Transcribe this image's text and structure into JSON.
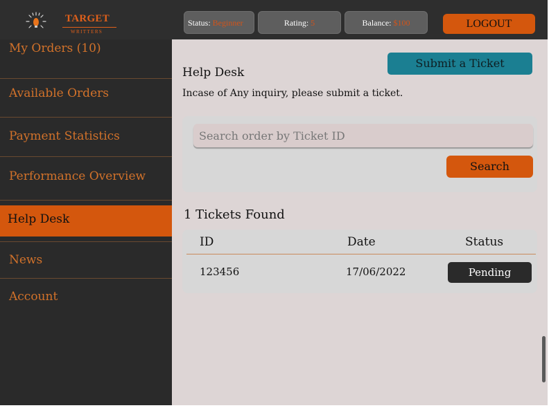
{
  "logo": {
    "title": "TARGET",
    "subtitle": "WRITTERS"
  },
  "header": {
    "status_label": "Status:",
    "status_value": "Beginner",
    "rating_label": "Rating:",
    "rating_value": "5",
    "balance_label": "Balance:",
    "balance_value": "$100",
    "logout_label": "LOGOUT"
  },
  "sidebar": {
    "items": [
      {
        "label": "My Orders (10)"
      },
      {
        "label": "Available Orders"
      },
      {
        "label": "Payment Statistics"
      },
      {
        "label": "Performance Overview"
      },
      {
        "label": "Help Desk"
      },
      {
        "label": "News"
      },
      {
        "label": "Account"
      }
    ],
    "active": "Help Desk"
  },
  "main": {
    "submit_label": "Submit a Ticket",
    "title": "Help Desk",
    "description": "Incase of Any inquiry, please submit a ticket.",
    "search": {
      "placeholder": "Search order by Ticket ID",
      "value": "",
      "button_label": "Search"
    },
    "results_count": "1 Tickets Found",
    "table": {
      "headers": [
        "ID",
        "Date",
        "Status"
      ],
      "rows": [
        {
          "id": "123456",
          "date": "17/06/2022",
          "status": "Pending"
        }
      ]
    }
  },
  "colors": {
    "accent": "#d4570d",
    "sidebar_bg": "#2a2a2a",
    "content_bg": "#ddd5d5",
    "submit_button": "#1b7f92"
  },
  "icons": {
    "logo": "lightbulb-icon"
  }
}
